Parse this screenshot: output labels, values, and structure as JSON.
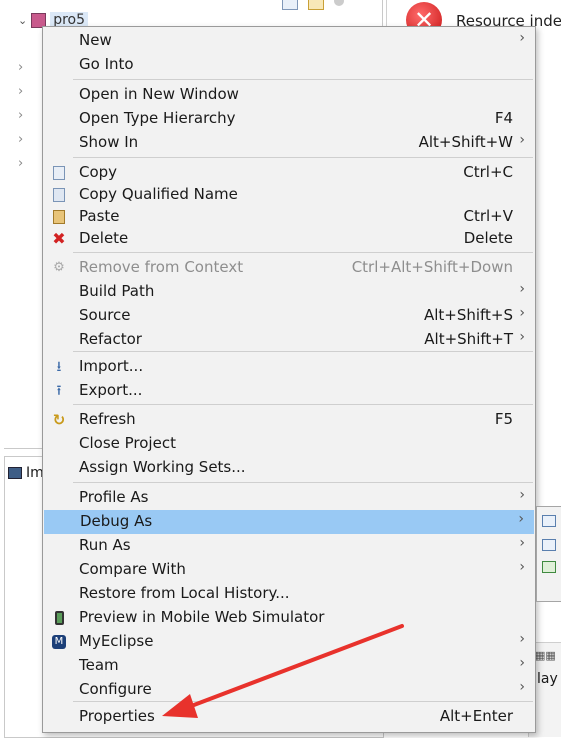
{
  "project_explorer": {
    "project_name": "pro5",
    "collapsed_rows": 5,
    "bottom_tab_label": "Im"
  },
  "problems_view": {
    "error_title": "Resource inde"
  },
  "console_view": {
    "tab_text": "lay"
  },
  "context_menu": {
    "groups": [
      [
        {
          "label": "New",
          "shortcut": "",
          "submenu": true,
          "icon": "",
          "disabled": false
        },
        {
          "label": "Go Into",
          "shortcut": "",
          "submenu": false,
          "icon": "",
          "disabled": false
        }
      ],
      [
        {
          "label": "Open in New Window",
          "shortcut": "",
          "submenu": false,
          "icon": "",
          "disabled": false
        },
        {
          "label": "Open Type Hierarchy",
          "shortcut": "F4",
          "submenu": false,
          "icon": "",
          "disabled": false
        },
        {
          "label": "Show In",
          "shortcut": "Alt+Shift+W",
          "submenu": true,
          "icon": "",
          "disabled": false
        }
      ],
      [
        {
          "label": "Copy",
          "shortcut": "Ctrl+C",
          "submenu": false,
          "icon": "copy-icon",
          "disabled": false
        },
        {
          "label": "Copy Qualified Name",
          "shortcut": "",
          "submenu": false,
          "icon": "copy-qualified-icon",
          "disabled": false
        },
        {
          "label": "Paste",
          "shortcut": "Ctrl+V",
          "submenu": false,
          "icon": "paste-icon",
          "disabled": false
        },
        {
          "label": "Delete",
          "shortcut": "Delete",
          "submenu": false,
          "icon": "delete-icon",
          "disabled": false
        }
      ],
      [
        {
          "label": "Remove from Context",
          "shortcut": "Ctrl+Alt+Shift+Down",
          "submenu": false,
          "icon": "remove-context-icon",
          "disabled": true
        },
        {
          "label": "Build Path",
          "shortcut": "",
          "submenu": true,
          "icon": "",
          "disabled": false
        },
        {
          "label": "Source",
          "shortcut": "Alt+Shift+S",
          "submenu": true,
          "icon": "",
          "disabled": false
        },
        {
          "label": "Refactor",
          "shortcut": "Alt+Shift+T",
          "submenu": true,
          "icon": "",
          "disabled": false
        }
      ],
      [
        {
          "label": "Import...",
          "shortcut": "",
          "submenu": false,
          "icon": "import-icon",
          "disabled": false
        },
        {
          "label": "Export...",
          "shortcut": "",
          "submenu": false,
          "icon": "export-icon",
          "disabled": false
        }
      ],
      [
        {
          "label": "Refresh",
          "shortcut": "F5",
          "submenu": false,
          "icon": "refresh-icon",
          "disabled": false
        },
        {
          "label": "Close Project",
          "shortcut": "",
          "submenu": false,
          "icon": "",
          "disabled": false
        },
        {
          "label": "Assign Working Sets...",
          "shortcut": "",
          "submenu": false,
          "icon": "",
          "disabled": false
        }
      ],
      [
        {
          "label": "Profile As",
          "shortcut": "",
          "submenu": true,
          "icon": "",
          "disabled": false
        },
        {
          "label": "Debug As",
          "shortcut": "",
          "submenu": true,
          "icon": "",
          "disabled": false,
          "highlighted": true
        },
        {
          "label": "Run As",
          "shortcut": "",
          "submenu": true,
          "icon": "",
          "disabled": false
        },
        {
          "label": "Compare With",
          "shortcut": "",
          "submenu": true,
          "icon": "",
          "disabled": false
        },
        {
          "label": "Restore from Local History...",
          "shortcut": "",
          "submenu": false,
          "icon": "",
          "disabled": false
        },
        {
          "label": "Preview in Mobile Web Simulator",
          "shortcut": "",
          "submenu": false,
          "icon": "mobile-simulator-icon",
          "disabled": false
        },
        {
          "label": "MyEclipse",
          "shortcut": "",
          "submenu": true,
          "icon": "myeclipse-icon",
          "disabled": false
        },
        {
          "label": "Team",
          "shortcut": "",
          "submenu": true,
          "icon": "",
          "disabled": false
        },
        {
          "label": "Configure",
          "shortcut": "",
          "submenu": true,
          "icon": "",
          "disabled": false
        }
      ],
      [
        {
          "label": "Properties",
          "shortcut": "Alt+Enter",
          "submenu": false,
          "icon": "",
          "disabled": false
        }
      ]
    ]
  },
  "colors": {
    "menu_background": "#f2f2f2",
    "highlight": "#99c9f4",
    "annotation_arrow": "#e8322c",
    "disabled_text": "#8e8e8e"
  }
}
